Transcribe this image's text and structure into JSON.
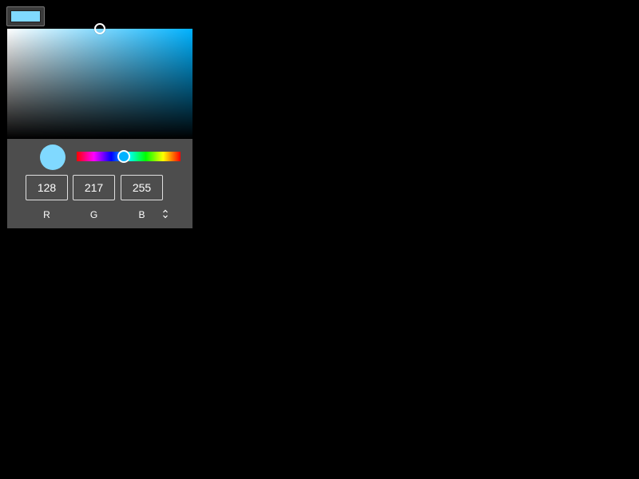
{
  "color": {
    "hex": "#80d9ff",
    "hue_color": "#00b2ff",
    "saturation_pct": 50,
    "value_pct": 100,
    "hue_deg": 198
  },
  "channels": [
    {
      "label": "R",
      "value": "128"
    },
    {
      "label": "G",
      "value": "217"
    },
    {
      "label": "B",
      "value": "255"
    }
  ],
  "icons": {
    "mode_toggle": "up-down-chevron-icon"
  }
}
